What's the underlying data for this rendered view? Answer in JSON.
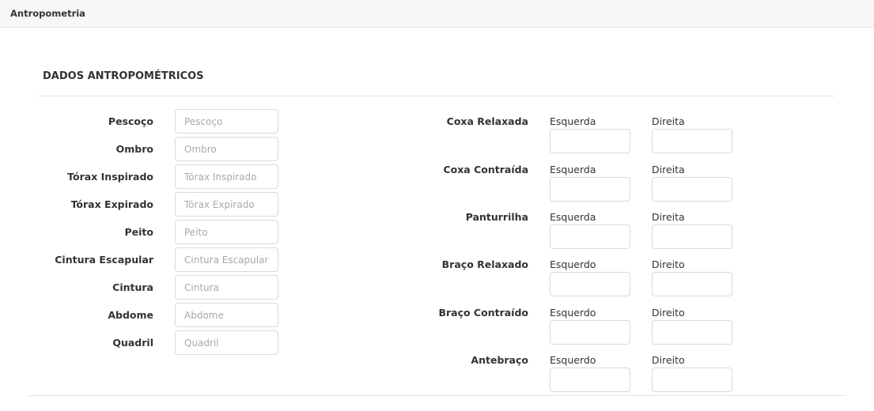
{
  "panel": {
    "title": "Antropometria"
  },
  "section": {
    "title": "DADOS ANTROPOMÉTRICOS"
  },
  "left_fields": [
    {
      "label": "Pescoço",
      "placeholder": "Pescoço",
      "value": ""
    },
    {
      "label": "Ombro",
      "placeholder": "Ombro",
      "value": ""
    },
    {
      "label": "Tórax Inspirado",
      "placeholder": "Tórax Inspirado",
      "value": ""
    },
    {
      "label": "Tórax Expirado",
      "placeholder": "Tórax Expirado",
      "value": ""
    },
    {
      "label": "Peito",
      "placeholder": "Peito",
      "value": ""
    },
    {
      "label": "Cintura Escapular",
      "placeholder": "Cintura Escapular",
      "value": ""
    },
    {
      "label": "Cintura",
      "placeholder": "Cintura",
      "value": ""
    },
    {
      "label": "Abdome",
      "placeholder": "Abdome",
      "value": ""
    },
    {
      "label": "Quadril",
      "placeholder": "Quadril",
      "value": ""
    }
  ],
  "right_fields": [
    {
      "label": "Coxa Relaxada",
      "left_label": "Esquerda",
      "right_label": "Direita",
      "left_value": "",
      "right_value": ""
    },
    {
      "label": "Coxa Contraída",
      "left_label": "Esquerda",
      "right_label": "Direita",
      "left_value": "",
      "right_value": ""
    },
    {
      "label": "Panturrilha",
      "left_label": "Esquerda",
      "right_label": "Direita",
      "left_value": "",
      "right_value": ""
    },
    {
      "label": "Braço Relaxado",
      "left_label": "Esquerdo",
      "right_label": "Direito",
      "left_value": "",
      "right_value": ""
    },
    {
      "label": "Braço Contraído",
      "left_label": "Esquerdo",
      "right_label": "Direito",
      "left_value": "",
      "right_value": ""
    },
    {
      "label": "Antebraço",
      "left_label": "Esquerdo",
      "right_label": "Direito",
      "left_value": "",
      "right_value": ""
    }
  ]
}
